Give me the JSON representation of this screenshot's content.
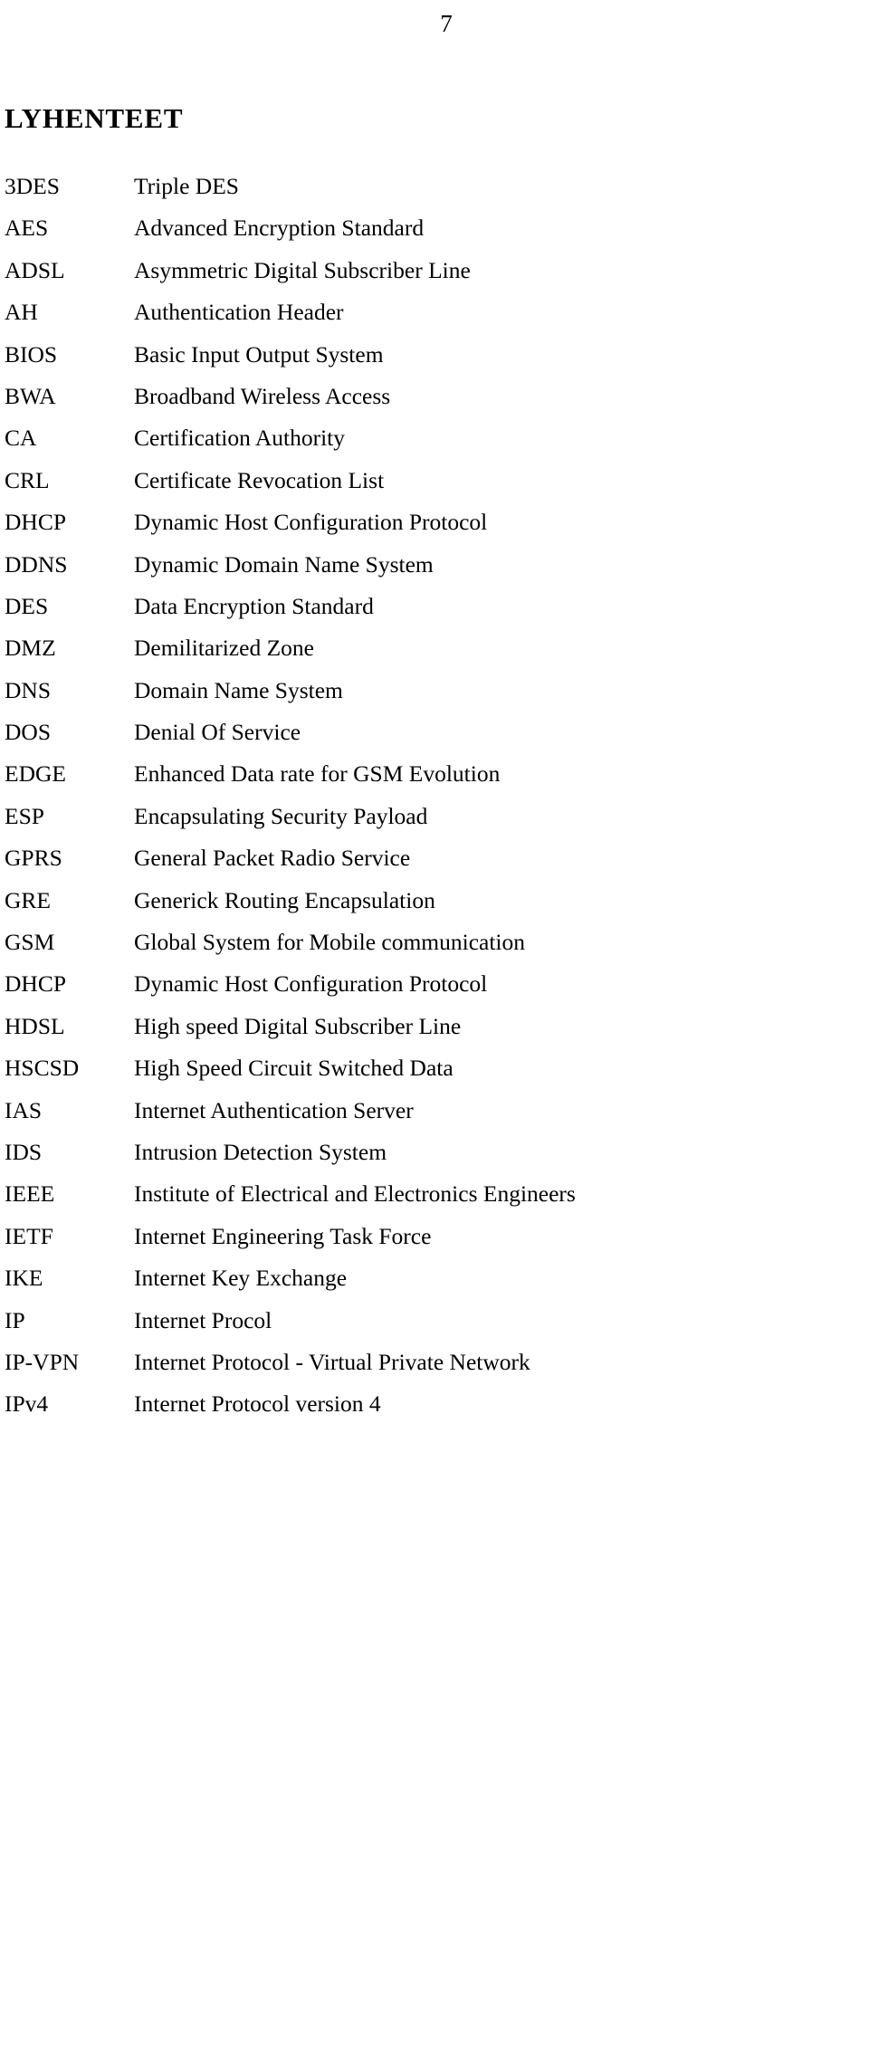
{
  "page": {
    "page_number": "7",
    "heading": "LYHENTEET"
  },
  "abbreviations": [
    {
      "term": "3DES",
      "definition": "Triple DES"
    },
    {
      "term": "AES",
      "definition": "Advanced Encryption Standard"
    },
    {
      "term": "ADSL",
      "definition": "Asymmetric Digital Subscriber Line"
    },
    {
      "term": "AH",
      "definition": "Authentication Header"
    },
    {
      "term": "BIOS",
      "definition": "Basic Input Output System"
    },
    {
      "term": "BWA",
      "definition": "Broadband Wireless Access"
    },
    {
      "term": "CA",
      "definition": "Certification Authority"
    },
    {
      "term": "CRL",
      "definition": "Certificate Revocation List"
    },
    {
      "term": "DHCP",
      "definition": "Dynamic Host Configuration Protocol"
    },
    {
      "term": "DDNS",
      "definition": "Dynamic Domain Name System"
    },
    {
      "term": "DES",
      "definition": "Data Encryption Standard"
    },
    {
      "term": "DMZ",
      "definition": "Demilitarized Zone"
    },
    {
      "term": "DNS",
      "definition": "Domain Name System"
    },
    {
      "term": "DOS",
      "definition": "Denial Of Service"
    },
    {
      "term": "EDGE",
      "definition": "Enhanced Data rate for GSM Evolution"
    },
    {
      "term": "ESP",
      "definition": "Encapsulating Security Payload"
    },
    {
      "term": "GPRS",
      "definition": "General Packet Radio Service"
    },
    {
      "term": "GRE",
      "definition": "Generick Routing Encapsulation"
    },
    {
      "term": "GSM",
      "definition": "Global System for Mobile communication"
    },
    {
      "term": "DHCP",
      "definition": "Dynamic Host Configuration Protocol"
    },
    {
      "term": "HDSL",
      "definition": "High speed Digital Subscriber Line"
    },
    {
      "term": "HSCSD",
      "definition": "High Speed Circuit Switched Data"
    },
    {
      "term": "IAS",
      "definition": "Internet Authentication Server"
    },
    {
      "term": "IDS",
      "definition": "Intrusion Detection System"
    },
    {
      "term": "IEEE",
      "definition": "Institute of Electrical and Electronics Engineers"
    },
    {
      "term": "IETF",
      "definition": "Internet Engineering Task Force"
    },
    {
      "term": "IKE",
      "definition": "Internet Key Exchange"
    },
    {
      "term": "IP",
      "definition": "Internet Procol"
    },
    {
      "term": "IP-VPN",
      "definition": "Internet Protocol - Virtual Private Network"
    },
    {
      "term": "IPv4",
      "definition": "Internet Protocol version 4"
    }
  ]
}
